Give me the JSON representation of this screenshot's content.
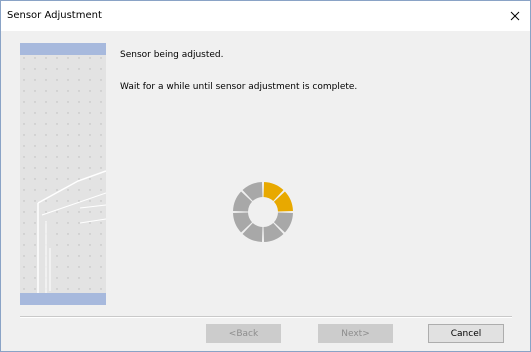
{
  "window": {
    "title": "Sensor Adjustment",
    "close_symbol": "✕"
  },
  "main": {
    "status_message": "Sensor being adjusted.",
    "instruction_message": "Wait for a while until sensor adjustment is complete."
  },
  "spinner": {
    "icon": "loading-spinner-icon",
    "segments": 8,
    "active_color": "#e8a900",
    "inactive_color": "#a8a8a8"
  },
  "footer": {
    "back_label": "<Back",
    "next_label": "Next>",
    "cancel_label": "Cancel"
  },
  "colors": {
    "side_band": "#a7b9dd",
    "side_bg": "#e3e3e3"
  }
}
